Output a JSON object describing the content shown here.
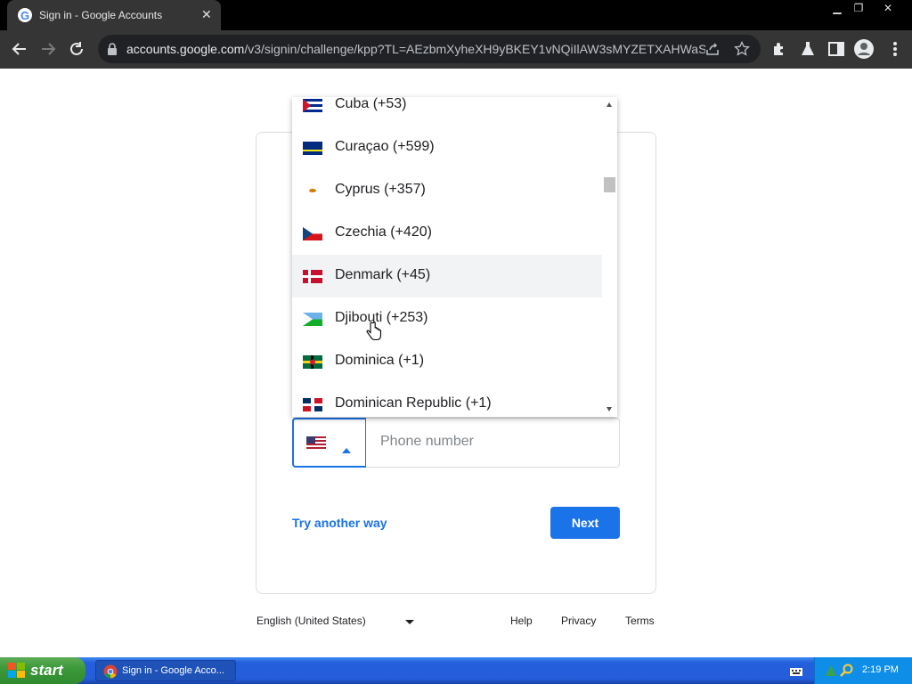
{
  "browser": {
    "tab_title": "Sign in - Google Accounts",
    "tab_close": "✕",
    "window_controls": {
      "minimize": "▁",
      "restore": "❐",
      "close": "✕"
    },
    "url_host": "accounts.google.com",
    "url_path": "/v3/signin/challenge/kpp?TL=AEzbmXyheXH9yBKEY1vNQiIlAW3sMYZETXAHWaS..."
  },
  "dropdown": {
    "items": [
      {
        "label": "Cuba (+53)",
        "flag": "cuba"
      },
      {
        "label": "Curaçao (+599)",
        "flag": "curacao"
      },
      {
        "label": "Cyprus (+357)",
        "flag": "cyprus"
      },
      {
        "label": "Czechia (+420)",
        "flag": "czechia"
      },
      {
        "label": "Denmark (+45)",
        "flag": "denmark",
        "highlighted": true
      },
      {
        "label": "Djibouti (+253)",
        "flag": "djibouti"
      },
      {
        "label": "Dominica (+1)",
        "flag": "dominica"
      },
      {
        "label": "Dominican Republic (+1)",
        "flag": "dominican-republic"
      }
    ]
  },
  "form": {
    "selected_country_flag": "united-states",
    "phone_placeholder": "Phone number",
    "try_another_way": "Try another way",
    "next": "Next"
  },
  "footer": {
    "language": "English (United States)",
    "help": "Help",
    "privacy": "Privacy",
    "terms": "Terms"
  },
  "taskbar": {
    "start": "start",
    "task_item": "Sign in - Google Acco...",
    "clock": "2:19 PM"
  },
  "colors": {
    "accent": "#1a73e8",
    "toolbar": "#353535",
    "taskbar": "#245edb"
  }
}
